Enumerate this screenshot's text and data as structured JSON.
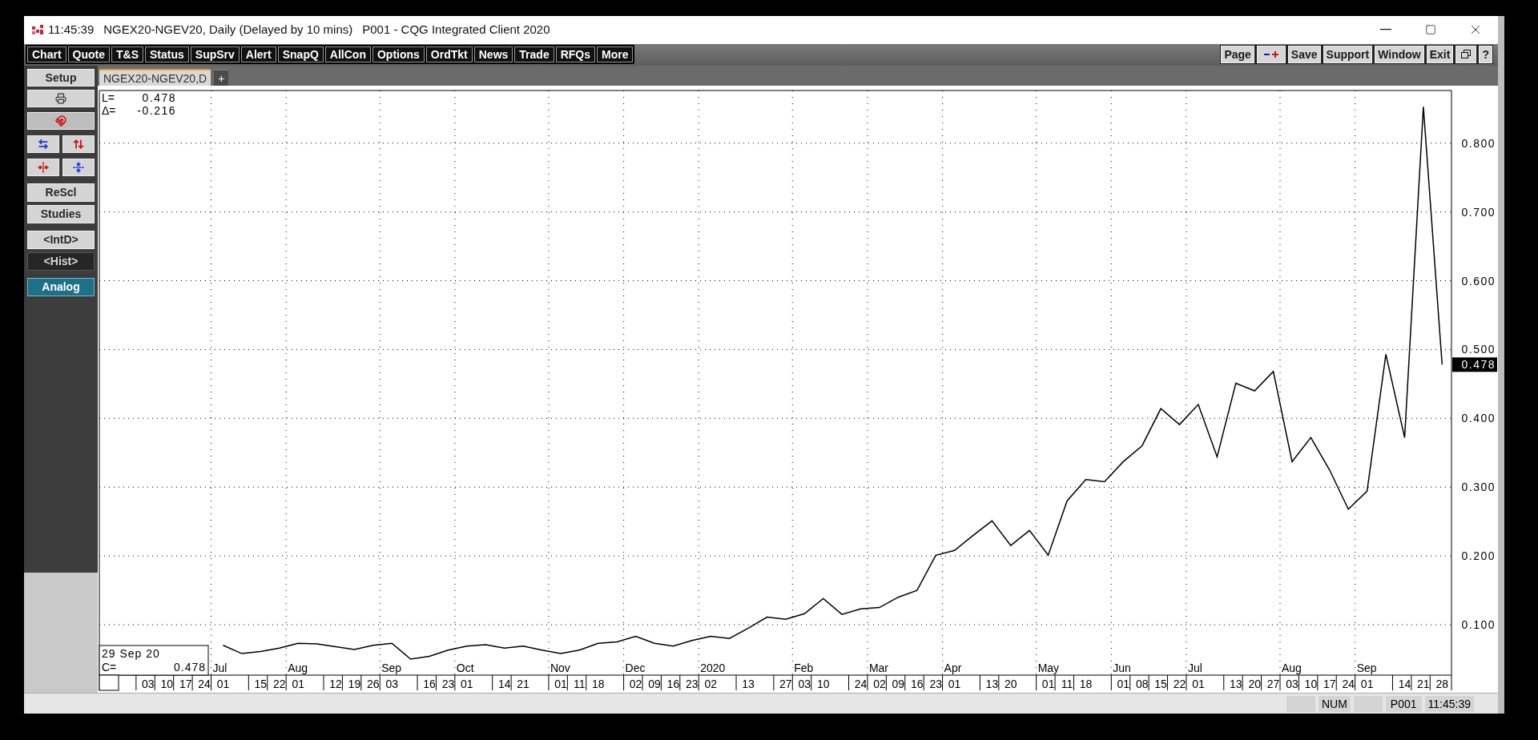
{
  "title_bar": {
    "time": "11:45:39",
    "title": "NGEX20-NGEV20, Daily (Delayed by 10 mins)",
    "app": "P001 - CQG Integrated Client 2020"
  },
  "toolbar": {
    "left_buttons": [
      "Chart",
      "Quote",
      "T&S",
      "Status",
      "SupSrv",
      "Alert",
      "SnapQ",
      "AllCon",
      "Options",
      "OrdTkt",
      "News",
      "Trade",
      "RFQs",
      "More"
    ],
    "right_buttons": [
      {
        "kind": "text",
        "label": "Page"
      },
      {
        "kind": "zoom"
      },
      {
        "kind": "text",
        "label": "Save"
      },
      {
        "kind": "text",
        "label": "Support"
      },
      {
        "kind": "text",
        "label": "Window"
      },
      {
        "kind": "text",
        "label": "Exit"
      },
      {
        "kind": "restore"
      },
      {
        "kind": "text",
        "label": "?"
      }
    ]
  },
  "sidebar": {
    "setup": "Setup",
    "buttons": [
      {
        "label": "ReScl",
        "selected": false,
        "on": false
      },
      {
        "label": "Studies",
        "selected": false,
        "on": false
      },
      {
        "label": "<IntD>",
        "selected": false,
        "on": false
      },
      {
        "label": "<Hist>",
        "selected": true,
        "on": false
      },
      {
        "label": "Analog",
        "selected": false,
        "on": true
      }
    ]
  },
  "tabs": [
    {
      "label": "NGEX20-NGEV20,D",
      "selected": true
    },
    {
      "label": "+",
      "selected": false
    }
  ],
  "chart": {
    "readout": {
      "last_label": "L=",
      "last": "0.478",
      "delta_label": "Δ=",
      "delta": "-0.216"
    },
    "legend": {
      "date": "29 Sep 20",
      "close_label": "C=",
      "close": "0.478"
    },
    "price_marker": "0.478",
    "month_labels": [
      "Jul",
      "Aug",
      "Sep",
      "Oct",
      "Nov",
      "Dec",
      "2020",
      "Feb",
      "Mar",
      "Apr",
      "May",
      "Jun",
      "Jul",
      "Aug",
      "Sep"
    ],
    "chart_data": {
      "type": "line",
      "grid": true,
      "categories": [
        "03",
        "10",
        "17",
        "24",
        "01",
        null,
        "15",
        "22",
        "01",
        null,
        "12",
        "19",
        "26",
        "03",
        null,
        "16",
        "23",
        "01",
        null,
        "14",
        "21",
        null,
        "01",
        "11",
        "18",
        null,
        "02",
        "09",
        "16",
        "23",
        "02",
        null,
        "13",
        null,
        "27",
        "03",
        "10",
        null,
        "24",
        "02",
        "09",
        "16",
        "23",
        "01",
        null,
        "13",
        "20",
        null,
        "01",
        "11",
        "18",
        null,
        "01",
        "08",
        "15",
        "22",
        "01",
        null,
        "13",
        "20",
        "27",
        "03",
        "10",
        "17",
        "24",
        "01",
        null,
        "14",
        "21",
        "28"
      ],
      "series": [
        {
          "color": "#000000",
          "values": [
            null,
            null,
            null,
            null,
            0.07,
            0.058,
            0.061,
            0.066,
            0.073,
            0.072,
            0.068,
            0.064,
            0.07,
            0.073,
            0.05,
            0.054,
            0.063,
            0.069,
            0.071,
            0.066,
            0.069,
            0.063,
            0.058,
            0.063,
            0.073,
            0.075,
            0.083,
            0.073,
            0.069,
            0.077,
            0.083,
            0.08,
            0.095,
            0.111,
            0.108,
            0.116,
            0.138,
            0.115,
            0.123,
            0.125,
            0.14,
            0.15,
            0.201,
            0.208,
            0.23,
            0.251,
            0.215,
            0.237,
            0.201,
            0.28,
            0.311,
            0.308,
            0.337,
            0.36,
            0.414,
            0.391,
            0.42,
            0.344,
            0.451,
            0.44,
            0.468,
            0.337,
            0.372,
            0.325,
            0.268,
            0.294,
            0.493,
            0.372,
            0.853,
            0.478
          ]
        }
      ],
      "ylim": [
        0.0267,
        0.8765
      ],
      "yticks": [
        {
          "value": 0.1,
          "label": "0.100"
        },
        {
          "value": 0.2,
          "label": "0.200"
        },
        {
          "value": 0.3,
          "label": "0.300"
        },
        {
          "value": 0.4,
          "label": "0.400"
        },
        {
          "value": 0.5,
          "label": "0.500"
        },
        {
          "value": 0.6,
          "label": "0.600"
        },
        {
          "value": 0.7,
          "label": "0.700"
        },
        {
          "value": 0.8,
          "label": "0.800"
        }
      ]
    }
  },
  "status_bar": [
    "NUM",
    "P001",
    "11:45:39"
  ]
}
